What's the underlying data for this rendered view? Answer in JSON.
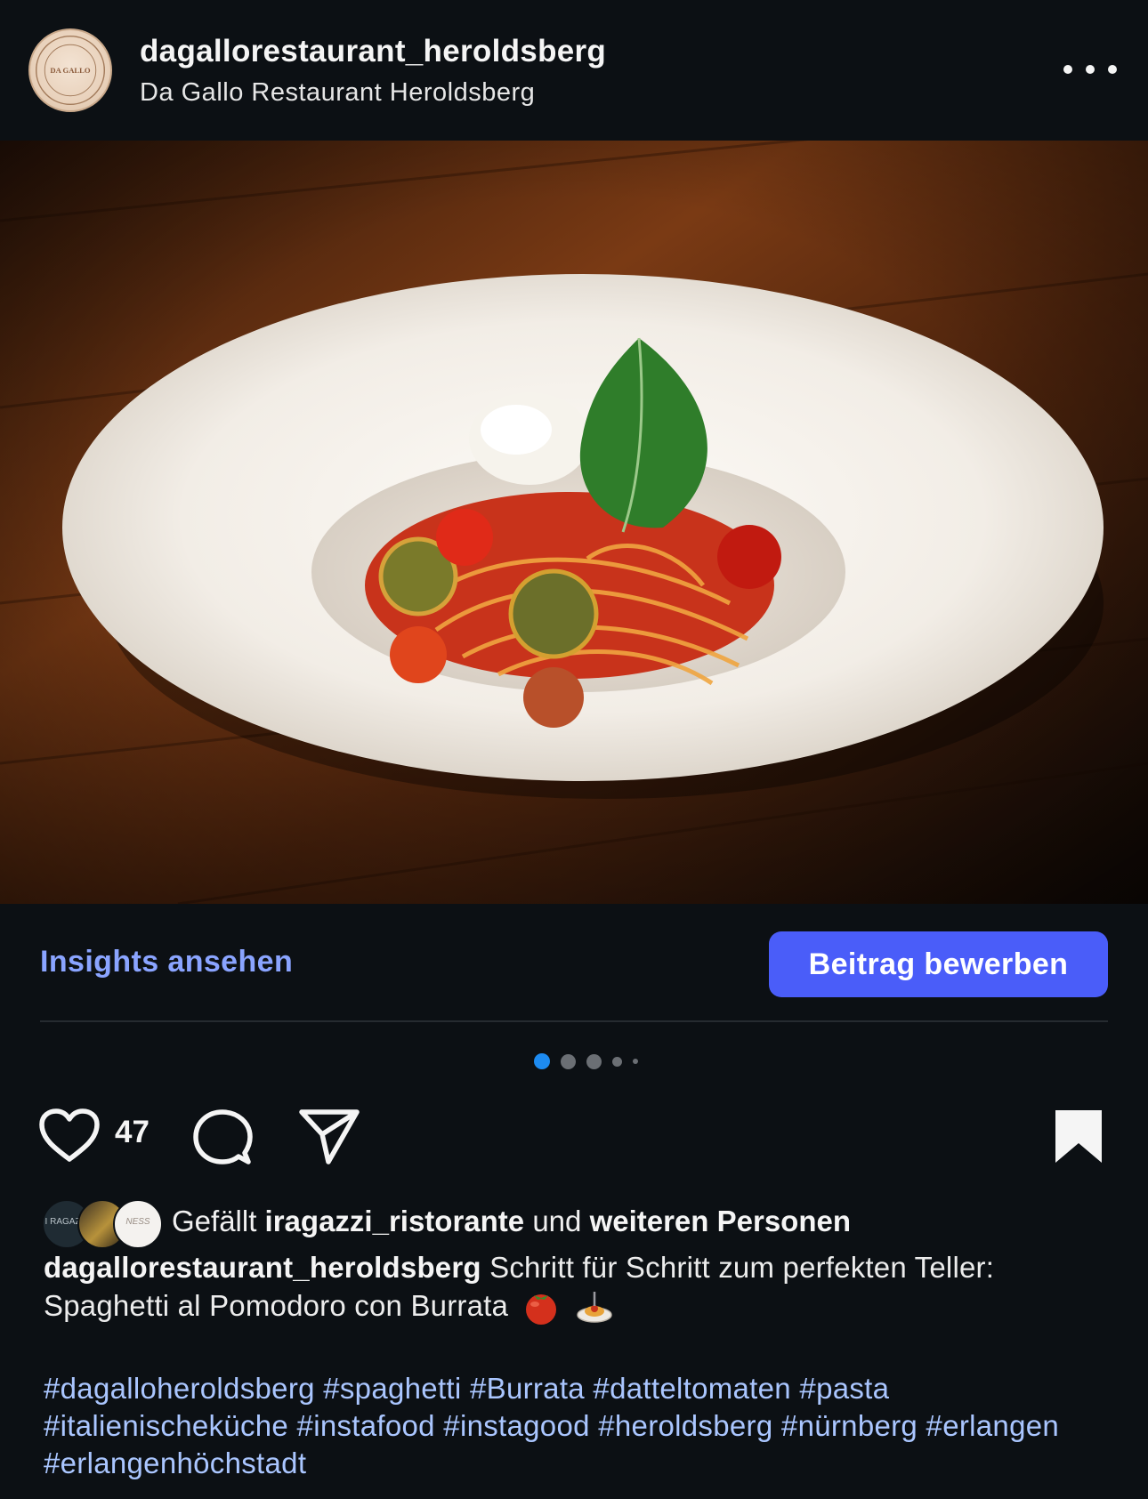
{
  "header": {
    "username": "dagallorestaurant_heroldsberg",
    "display_name": "Da Gallo Restaurant Heroldsberg",
    "avatar_icon": "da-gallo-logo-icon",
    "avatar_text": "DA GALLO",
    "more_icon": "more-options-icon"
  },
  "post": {
    "image_alt": "Spaghetti al Pomodoro con Burrata",
    "carousel": {
      "count": 5,
      "active_index": 0
    }
  },
  "owner_actions": {
    "insights_label": "Insights ansehen",
    "promote_label": "Beitrag bewerben"
  },
  "actions": {
    "like_icon": "heart-icon",
    "like_count": "47",
    "comment_icon": "comment-icon",
    "share_icon": "send-icon",
    "save_icon": "bookmark-icon"
  },
  "likes": {
    "prefix": "Gefällt",
    "first_user": "iragazzi_ristorante",
    "middle": "und",
    "rest": "weiteren Personen",
    "avatars": [
      "I RAGAZZI",
      "",
      "NESS"
    ]
  },
  "caption": {
    "username": "dagallorestaurant_heroldsberg",
    "text": "Schritt für Schritt zum perfekten Teller: Spaghetti al Pomodoro con Burrata",
    "emojis": [
      "tomato-emoji",
      "spaghetti-emoji"
    ],
    "hashtags": "#dagalloheroldsberg #spaghetti #Burrata #datteltomaten #pasta #italienischeküche #instafood #instagood #heroldsberg #nürnberg #erlangen #erlangenhöchstadt"
  },
  "colors": {
    "background": "#0c1014",
    "accent_link": "#8aa4ff",
    "promote_button": "#4a5df9",
    "active_dot": "#1d8bf1",
    "hashtag": "#aac6ff"
  }
}
